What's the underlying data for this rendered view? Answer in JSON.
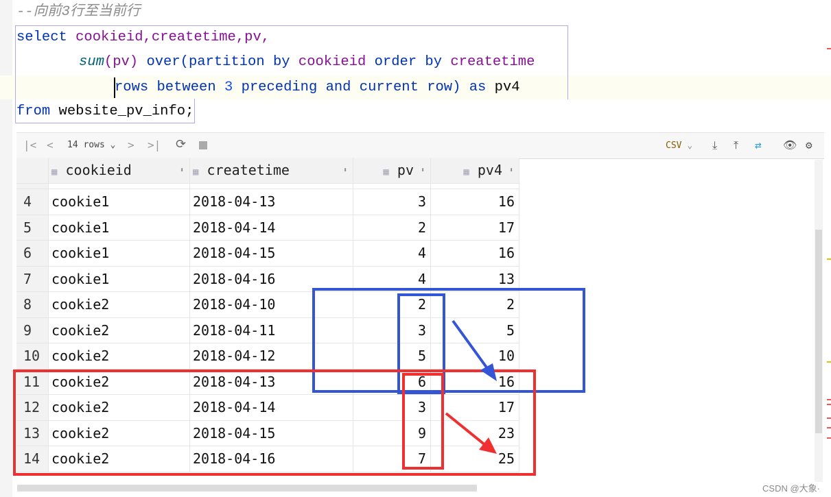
{
  "editor": {
    "comment": "--向前3行至当前行",
    "line1": {
      "kw": "select",
      "cols": "cookieid,createtime,pv,"
    },
    "line2": {
      "fn": "sum",
      "arg": "(pv)",
      "over": "over(partition by",
      "col1": "cookieid",
      "order": "order by",
      "col2": "createtime"
    },
    "line3": {
      "rows": "rows between",
      "num": "3",
      "rest": "preceding and current row)",
      "as": "as",
      "alias": "pv4"
    },
    "line4": {
      "kw": "from",
      "table": "website_pv_info",
      ";": ";"
    }
  },
  "toolbar": {
    "rows_label": "14 rows",
    "export_format": "CSV"
  },
  "columns": [
    "cookieid",
    "createtime",
    "pv",
    "pv4"
  ],
  "rows": [
    [
      "4",
      "cookie1",
      "2018-04-13",
      "3",
      "16"
    ],
    [
      "5",
      "cookie1",
      "2018-04-14",
      "2",
      "17"
    ],
    [
      "6",
      "cookie1",
      "2018-04-15",
      "4",
      "16"
    ],
    [
      "7",
      "cookie1",
      "2018-04-16",
      "4",
      "13"
    ],
    [
      "8",
      "cookie2",
      "2018-04-10",
      "2",
      "2"
    ],
    [
      "9",
      "cookie2",
      "2018-04-11",
      "3",
      "5"
    ],
    [
      "10",
      "cookie2",
      "2018-04-12",
      "5",
      "10"
    ],
    [
      "11",
      "cookie2",
      "2018-04-13",
      "6",
      "16"
    ],
    [
      "12",
      "cookie2",
      "2018-04-14",
      "3",
      "17"
    ],
    [
      "13",
      "cookie2",
      "2018-04-15",
      "9",
      "23"
    ],
    [
      "14",
      "cookie2",
      "2018-04-16",
      "7",
      "25"
    ]
  ],
  "annotation_colors": {
    "blue": "#3355d6",
    "red": "#f03030"
  },
  "watermark": "CSDN @大象·"
}
